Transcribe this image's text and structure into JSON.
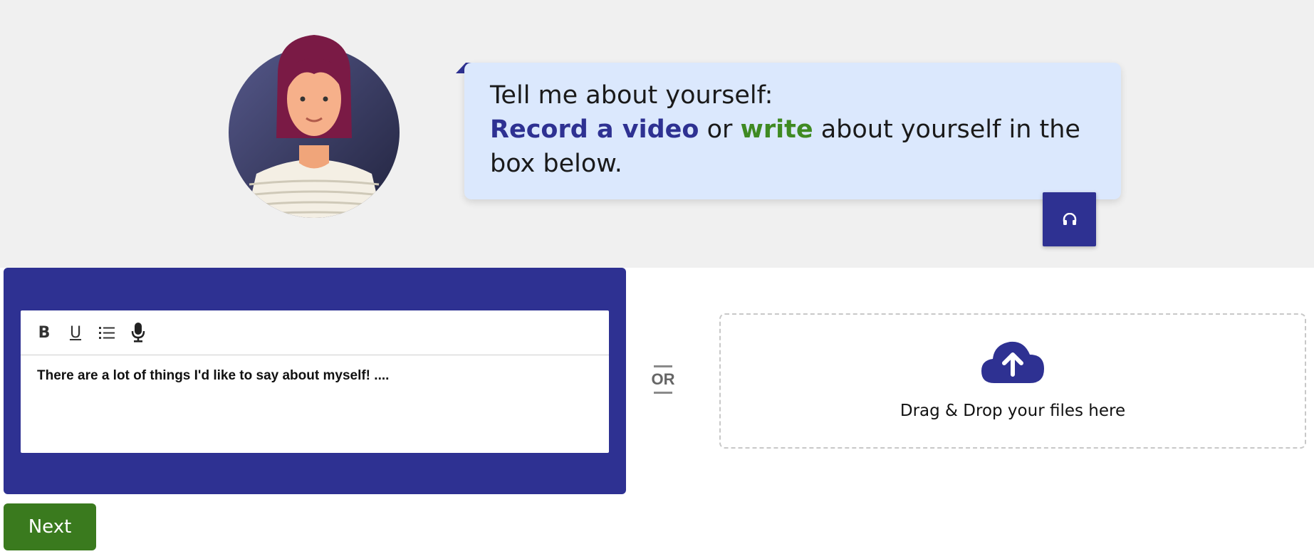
{
  "prompt": {
    "line1": "Tell me about yourself:",
    "link_video": "Record a video",
    "or_word": "or",
    "link_write": "write",
    "line2_rest": "about yourself in the box below.",
    "colors": {
      "bubble_bg": "#dbe8fd",
      "accent_blue": "#2e3192",
      "accent_green": "#3f8a22"
    }
  },
  "audio_button": {
    "icon": "headphones-icon"
  },
  "editor": {
    "toolbar": {
      "bold_label": "B",
      "underline_label": "U",
      "list_icon": "list-icon",
      "mic_icon": "microphone-icon"
    },
    "content": "There are a lot of things I'd like to say about myself! ...."
  },
  "separator": {
    "label": "OR"
  },
  "dropzone": {
    "icon": "cloud-upload-icon",
    "text": "Drag & Drop your files here"
  },
  "actions": {
    "next_label": "Next"
  }
}
